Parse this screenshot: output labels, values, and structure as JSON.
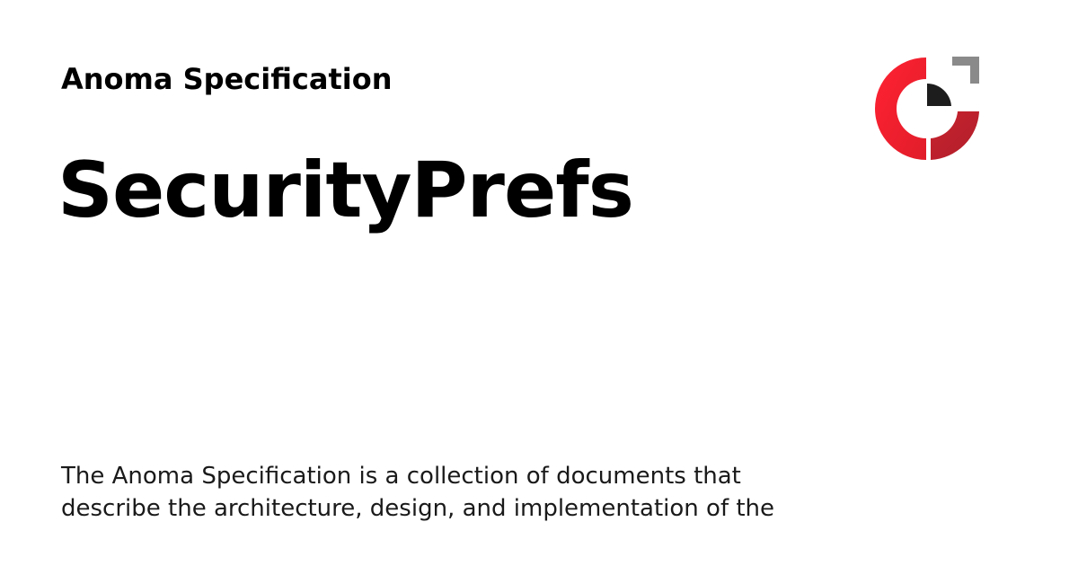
{
  "header": {
    "site_name": "Anoma Specification"
  },
  "page": {
    "title": "SecurityPrefs",
    "description": "The Anoma Specification is a collection of documents that describe the architecture, design, and implementation of the"
  },
  "logo": {
    "icon": "anoma-logo-icon",
    "colors": {
      "red": "#f2202e",
      "dark_red": "#c4232e",
      "black": "#1d1d1d",
      "grey": "#8a8a8a"
    }
  }
}
